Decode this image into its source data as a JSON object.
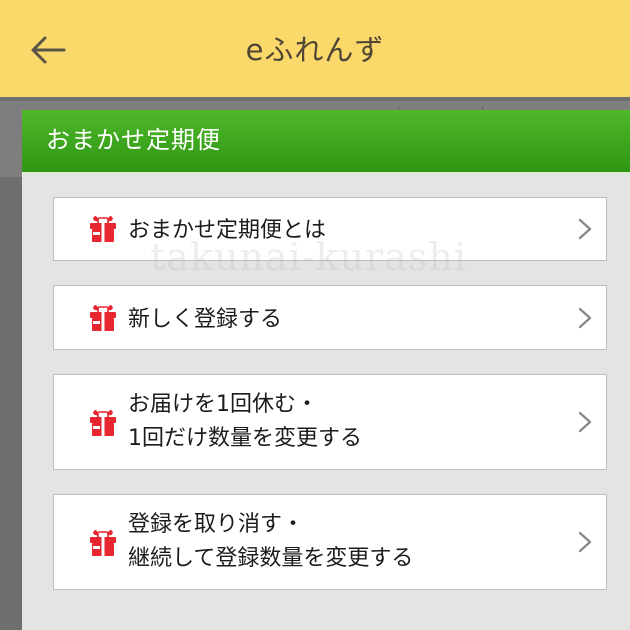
{
  "header": {
    "title": "eふれんず"
  },
  "icons": {
    "back": "back-arrow-icon",
    "menu_item": "gift-box-icon",
    "chevron": "chevron-right-icon"
  },
  "modal": {
    "title": "おまかせ定期便",
    "items": [
      {
        "lines": [
          "おまかせ定期便とは"
        ]
      },
      {
        "lines": [
          "新しく登録する"
        ]
      },
      {
        "lines": [
          "お届けを1回休む・",
          "1回だけ数量を変更する"
        ]
      },
      {
        "lines": [
          "登録を取り消す・",
          "継続して登録数量を変更する"
        ]
      }
    ]
  },
  "watermark": "takunai-kurashi",
  "colors": {
    "app_bar": "#fbd86a",
    "modal_header": "#3aa61a",
    "icon_red": "#e8262f"
  }
}
